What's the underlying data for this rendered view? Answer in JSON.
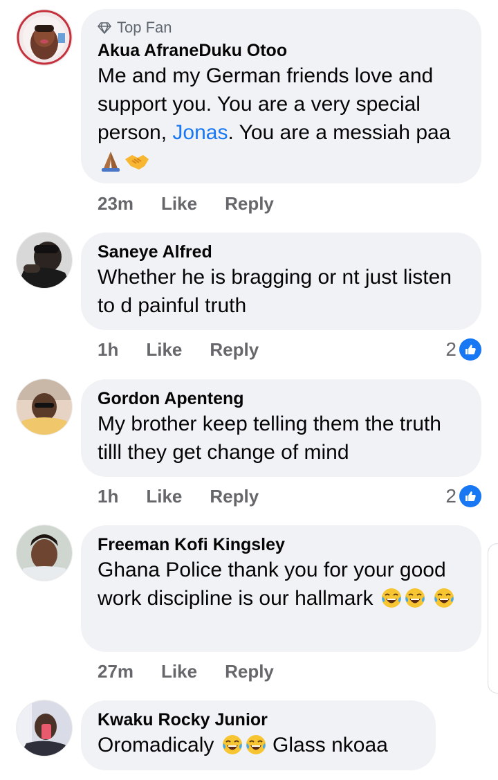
{
  "comments": [
    {
      "badge": "Top Fan",
      "author": "Akua AfraneDuku Otoo",
      "text_before": "Me and my German friends love and support you.  You are a very special person, ",
      "mention": "Jonas",
      "text_after": ". You are a messiah paa",
      "emojis": [
        "folded-hands-emoji",
        "handshake-emoji"
      ],
      "time": "23m",
      "like_label": "Like",
      "reply_label": "Reply"
    },
    {
      "author": "Saneye Alfred",
      "text": "Whether he is bragging or nt just listen to d painful truth",
      "time": "1h",
      "like_label": "Like",
      "reply_label": "Reply",
      "reaction_count": "2"
    },
    {
      "author": "Gordon Apenteng",
      "text": "My brother keep telling them the truth tilll they get change of mind",
      "time": "1h",
      "like_label": "Like",
      "reply_label": "Reply",
      "reaction_count": "2"
    },
    {
      "author": "Freeman Kofi Kingsley",
      "text": "Ghana Police thank you for your good work discipline is our hallmark",
      "emojis": [
        "laughing-tears-emoji",
        "laughing-tears-emoji",
        "laughing-tears-emoji"
      ],
      "time": "27m",
      "like_label": "Like",
      "reply_label": "Reply"
    },
    {
      "author": "Kwaku Rocky Junior",
      "text_before": "Oromadicaly ",
      "text_after": " Glass nkoaa",
      "emojis": [
        "laughing-tears-emoji",
        "laughing-tears-emoji"
      ]
    }
  ],
  "colors": {
    "bubble": "#f0f2f5",
    "mention": "#1877f2",
    "like_blue": "#1877f2",
    "meta_gray": "#65676b"
  }
}
